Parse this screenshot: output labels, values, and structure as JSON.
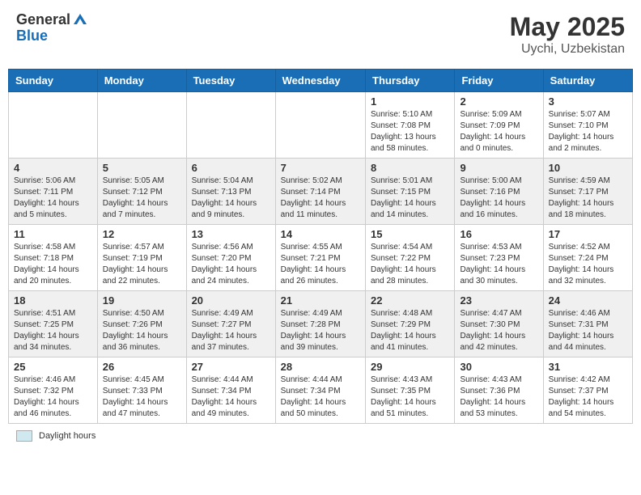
{
  "header": {
    "logo_general": "General",
    "logo_blue": "Blue",
    "month": "May 2025",
    "location": "Uychi, Uzbekistan"
  },
  "days_of_week": [
    "Sunday",
    "Monday",
    "Tuesday",
    "Wednesday",
    "Thursday",
    "Friday",
    "Saturday"
  ],
  "weeks": [
    [
      {
        "day": "",
        "info": ""
      },
      {
        "day": "",
        "info": ""
      },
      {
        "day": "",
        "info": ""
      },
      {
        "day": "",
        "info": ""
      },
      {
        "day": "1",
        "info": "Sunrise: 5:10 AM\nSunset: 7:08 PM\nDaylight: 13 hours\nand 58 minutes."
      },
      {
        "day": "2",
        "info": "Sunrise: 5:09 AM\nSunset: 7:09 PM\nDaylight: 14 hours\nand 0 minutes."
      },
      {
        "day": "3",
        "info": "Sunrise: 5:07 AM\nSunset: 7:10 PM\nDaylight: 14 hours\nand 2 minutes."
      }
    ],
    [
      {
        "day": "4",
        "info": "Sunrise: 5:06 AM\nSunset: 7:11 PM\nDaylight: 14 hours\nand 5 minutes."
      },
      {
        "day": "5",
        "info": "Sunrise: 5:05 AM\nSunset: 7:12 PM\nDaylight: 14 hours\nand 7 minutes."
      },
      {
        "day": "6",
        "info": "Sunrise: 5:04 AM\nSunset: 7:13 PM\nDaylight: 14 hours\nand 9 minutes."
      },
      {
        "day": "7",
        "info": "Sunrise: 5:02 AM\nSunset: 7:14 PM\nDaylight: 14 hours\nand 11 minutes."
      },
      {
        "day": "8",
        "info": "Sunrise: 5:01 AM\nSunset: 7:15 PM\nDaylight: 14 hours\nand 14 minutes."
      },
      {
        "day": "9",
        "info": "Sunrise: 5:00 AM\nSunset: 7:16 PM\nDaylight: 14 hours\nand 16 minutes."
      },
      {
        "day": "10",
        "info": "Sunrise: 4:59 AM\nSunset: 7:17 PM\nDaylight: 14 hours\nand 18 minutes."
      }
    ],
    [
      {
        "day": "11",
        "info": "Sunrise: 4:58 AM\nSunset: 7:18 PM\nDaylight: 14 hours\nand 20 minutes."
      },
      {
        "day": "12",
        "info": "Sunrise: 4:57 AM\nSunset: 7:19 PM\nDaylight: 14 hours\nand 22 minutes."
      },
      {
        "day": "13",
        "info": "Sunrise: 4:56 AM\nSunset: 7:20 PM\nDaylight: 14 hours\nand 24 minutes."
      },
      {
        "day": "14",
        "info": "Sunrise: 4:55 AM\nSunset: 7:21 PM\nDaylight: 14 hours\nand 26 minutes."
      },
      {
        "day": "15",
        "info": "Sunrise: 4:54 AM\nSunset: 7:22 PM\nDaylight: 14 hours\nand 28 minutes."
      },
      {
        "day": "16",
        "info": "Sunrise: 4:53 AM\nSunset: 7:23 PM\nDaylight: 14 hours\nand 30 minutes."
      },
      {
        "day": "17",
        "info": "Sunrise: 4:52 AM\nSunset: 7:24 PM\nDaylight: 14 hours\nand 32 minutes."
      }
    ],
    [
      {
        "day": "18",
        "info": "Sunrise: 4:51 AM\nSunset: 7:25 PM\nDaylight: 14 hours\nand 34 minutes."
      },
      {
        "day": "19",
        "info": "Sunrise: 4:50 AM\nSunset: 7:26 PM\nDaylight: 14 hours\nand 36 minutes."
      },
      {
        "day": "20",
        "info": "Sunrise: 4:49 AM\nSunset: 7:27 PM\nDaylight: 14 hours\nand 37 minutes."
      },
      {
        "day": "21",
        "info": "Sunrise: 4:49 AM\nSunset: 7:28 PM\nDaylight: 14 hours\nand 39 minutes."
      },
      {
        "day": "22",
        "info": "Sunrise: 4:48 AM\nSunset: 7:29 PM\nDaylight: 14 hours\nand 41 minutes."
      },
      {
        "day": "23",
        "info": "Sunrise: 4:47 AM\nSunset: 7:30 PM\nDaylight: 14 hours\nand 42 minutes."
      },
      {
        "day": "24",
        "info": "Sunrise: 4:46 AM\nSunset: 7:31 PM\nDaylight: 14 hours\nand 44 minutes."
      }
    ],
    [
      {
        "day": "25",
        "info": "Sunrise: 4:46 AM\nSunset: 7:32 PM\nDaylight: 14 hours\nand 46 minutes."
      },
      {
        "day": "26",
        "info": "Sunrise: 4:45 AM\nSunset: 7:33 PM\nDaylight: 14 hours\nand 47 minutes."
      },
      {
        "day": "27",
        "info": "Sunrise: 4:44 AM\nSunset: 7:34 PM\nDaylight: 14 hours\nand 49 minutes."
      },
      {
        "day": "28",
        "info": "Sunrise: 4:44 AM\nSunset: 7:34 PM\nDaylight: 14 hours\nand 50 minutes."
      },
      {
        "day": "29",
        "info": "Sunrise: 4:43 AM\nSunset: 7:35 PM\nDaylight: 14 hours\nand 51 minutes."
      },
      {
        "day": "30",
        "info": "Sunrise: 4:43 AM\nSunset: 7:36 PM\nDaylight: 14 hours\nand 53 minutes."
      },
      {
        "day": "31",
        "info": "Sunrise: 4:42 AM\nSunset: 7:37 PM\nDaylight: 14 hours\nand 54 minutes."
      }
    ]
  ],
  "footer": {
    "legend_label": "Daylight hours"
  }
}
